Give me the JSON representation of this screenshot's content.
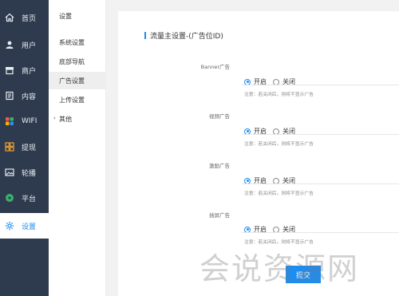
{
  "nav": {
    "items": [
      {
        "label": "首页",
        "icon": "home-icon"
      },
      {
        "label": "用户",
        "icon": "user-icon"
      },
      {
        "label": "商户",
        "icon": "store-icon"
      },
      {
        "label": "内容",
        "icon": "content-icon"
      },
      {
        "label": "WIFI",
        "icon": "wifi-grid-icon"
      },
      {
        "label": "提现",
        "icon": "withdraw-icon"
      },
      {
        "label": "轮播",
        "icon": "image-icon"
      },
      {
        "label": "平台",
        "icon": "platform-icon"
      },
      {
        "label": "设置",
        "icon": "gear-icon",
        "active": true
      }
    ]
  },
  "sub": {
    "title": "设置",
    "items": [
      {
        "label": "系统设置"
      },
      {
        "label": "底部导航"
      },
      {
        "label": "广告设置",
        "active": true
      },
      {
        "label": "上传设置"
      },
      {
        "label": "其他",
        "arrow": "›"
      }
    ]
  },
  "panel": {
    "title": "流量主设置-(广告位ID)",
    "fields": [
      {
        "label": "Banner广告",
        "on_label": "开启",
        "off_label": "关闭",
        "hint": "注意：若关闭后，则将不显示广告"
      },
      {
        "label": "视频广告",
        "on_label": "开启",
        "off_label": "关闭",
        "hint": "注意：若关闭后，则将不显示广告"
      },
      {
        "label": "激励广告",
        "on_label": "开启",
        "off_label": "关闭",
        "hint": "注意：若关闭后，则将不显示广告"
      },
      {
        "label": "插屏广告",
        "on_label": "开启",
        "off_label": "关闭",
        "hint": "注意：若关闭后，则将不显示广告"
      }
    ],
    "submit_label": "提交"
  },
  "watermark": "会说资源网",
  "colors": {
    "accent": "#1e8df0",
    "nav_bg": "#2e3b4e"
  }
}
